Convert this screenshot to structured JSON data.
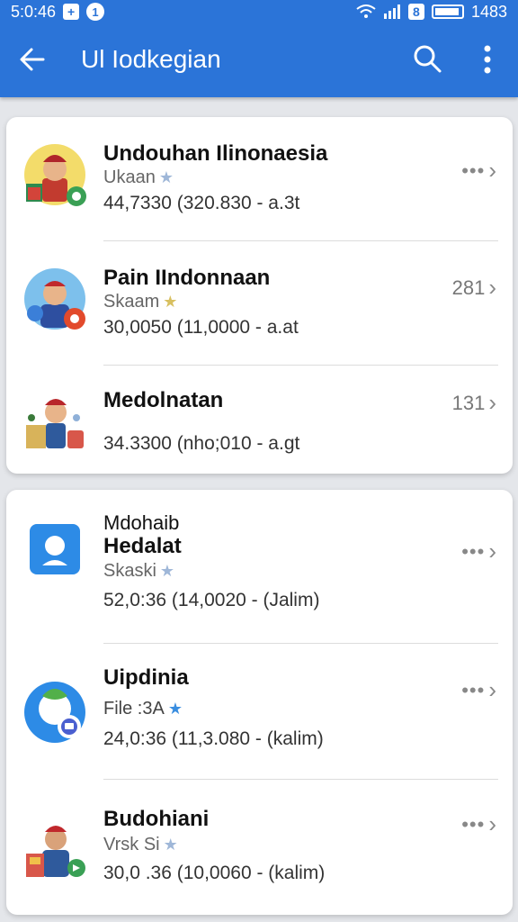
{
  "statusbar": {
    "time": "5:0:46",
    "icon_a": "+",
    "icon_b": "1",
    "right_icon": "8",
    "right_value": "1483"
  },
  "toolbar": {
    "title": "Ul Iodkegian"
  },
  "sections": [
    {
      "items": [
        {
          "name": "Undouhan Ilinonaesia",
          "subtitle": "Ukaan",
          "meta": "44,7330 (320.830 - a.3t",
          "right_count": "",
          "avatar": "person-gift-icon"
        },
        {
          "name": "Pain IIndonnaan",
          "subtitle": "Skaam",
          "meta": "30,0050 (11,0000 - a.at",
          "right_count": "281",
          "avatar": "person-badge-icon"
        },
        {
          "name": "Medolnatan",
          "subtitle": "",
          "meta": "34.3300 (nho;010 - a.gt",
          "right_count": "131",
          "avatar": "person-box-icon"
        }
      ]
    },
    {
      "items": [
        {
          "pretitle": "Mdohaib",
          "name": "Hedalat",
          "subtitle": "Skaski",
          "meta": "52,0:36 (14,0020 - (Jalim)",
          "right_count": "",
          "avatar": "blue-square-person-icon"
        },
        {
          "name": "Uipdinia",
          "subtitle": "File :3A",
          "meta": "24,0:36 (11,3.080 - (kalim)",
          "right_count": "",
          "avatar": "blue-circle-chat-icon"
        },
        {
          "name": "Budohiani",
          "subtitle": "Vrsk Si",
          "meta": "30,0 .36 (10,0060 - (kalim)",
          "right_count": "",
          "avatar": "person-bag-icon"
        }
      ]
    }
  ],
  "colors": {
    "appbar": "#2b74d8",
    "background": "#e4e6ea",
    "card": "#ffffff"
  }
}
